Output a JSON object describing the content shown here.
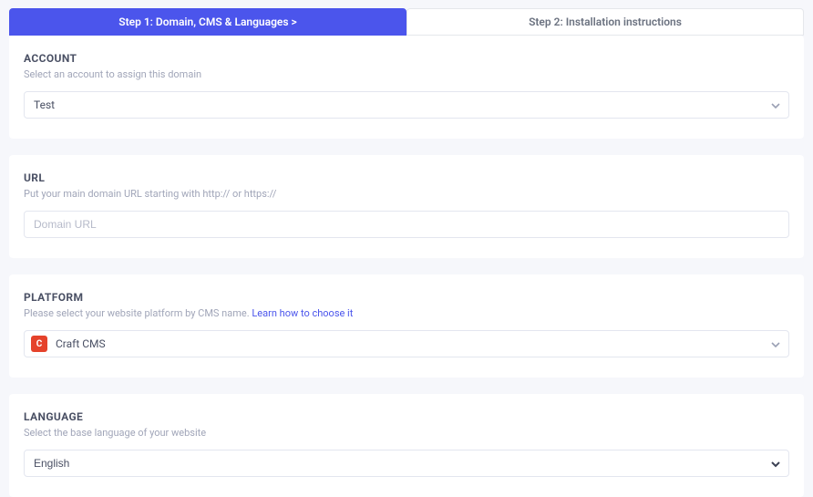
{
  "tabs": {
    "step1": "Step 1: Domain, CMS & Languages  >",
    "step2": "Step 2: Installation instructions"
  },
  "account": {
    "title": "ACCOUNT",
    "desc": "Select an account to assign this domain",
    "value": "Test"
  },
  "url": {
    "title": "URL",
    "desc": "Put your main domain URL starting with http:// or https://",
    "placeholder": "Domain URL",
    "value": ""
  },
  "platform": {
    "title": "PLATFORM",
    "desc_prefix": "Please select your website platform by CMS name. ",
    "link_text": "Learn how to choose it",
    "value": "Craft CMS",
    "icon_letter": "C"
  },
  "language": {
    "title": "LANGUAGE",
    "desc": "Select the base language of your website",
    "value": "English"
  }
}
